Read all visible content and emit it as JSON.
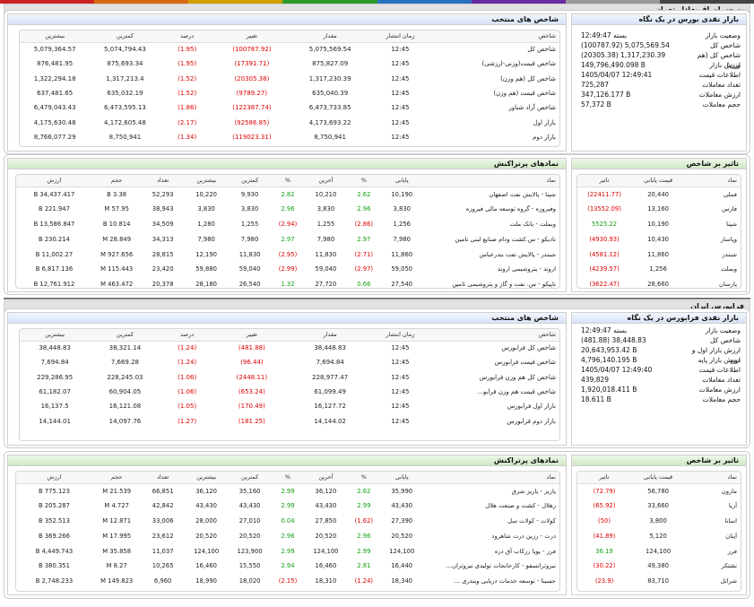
{
  "colors": {
    "accent_green": "#12a012",
    "accent_red": "#dd0000",
    "header_blue": "#d7e3f7",
    "header_green": "#cfe8c4"
  },
  "top_strip": [
    "#cc2222",
    "#d96a10",
    "#cfa000",
    "#2a9a2a",
    "#2a70c0",
    "#6a2aa0",
    "#999999",
    "#444444"
  ],
  "tse": {
    "section_title": "بورس اوراق بهادار تهران",
    "overview": {
      "title": "بازار نقدی بورس در یک نگاه",
      "rows": [
        {
          "label": "وضعیت بازار",
          "value": "بسته 12:49:47",
          "cls": ""
        },
        {
          "label": "شاخص کل",
          "value": "(100787.92) 5,075,569.54",
          "cls": "neg"
        },
        {
          "label": "شاخص کل (هم وزن)",
          "value": "(20305.38) 1,317,230.39",
          "cls": "neg"
        },
        {
          "label": "ارزش بازار",
          "value": "149,796,490.098 B",
          "cls": ""
        },
        {
          "label": "اطلاعات قیمت",
          "value": "1405/04/07 12:49:41",
          "cls": ""
        },
        {
          "label": "تعداد معاملات",
          "value": "725,287",
          "cls": ""
        },
        {
          "label": "ارزش معاملات",
          "value": "347,126.177 B",
          "cls": ""
        },
        {
          "label": "حجم معاملات",
          "value": "57,372 B",
          "cls": ""
        }
      ]
    },
    "indices": {
      "title": "شاخص های منتخب",
      "headers": [
        "شاخص",
        "زمان انتشار",
        "مقدار",
        "تغییر",
        "درصد",
        "کمترین",
        "بیشترین"
      ],
      "rows": [
        [
          "شاخص کل",
          "12:45",
          "5,075,569.54",
          "(100787.92)",
          "(1.95)",
          "5,074,794.43",
          "5,079,364.57"
        ],
        [
          "شاخص قیمت(وزنی-ارزشی)",
          "12:45",
          "875,827.09",
          "(17391.71)",
          "(1.95)",
          "875,693.34",
          "876,481.95"
        ],
        [
          "شاخص کل (هم وزن)",
          "12:45",
          "1,317,230.39",
          "(20305.38)",
          "(1.52)",
          "1,317,213.4",
          "1,322,294.18"
        ],
        [
          "شاخص قیمت (هم وزن)",
          "12:45",
          "635,040.39",
          "(9789.27)",
          "(1.52)",
          "635,032.19",
          "637,481.65"
        ],
        [
          "شاخص آزاد شناور",
          "12:45",
          "6,473,733.85",
          "(122387.74)",
          "(1.86)",
          "6,473,595.13",
          "6,479,043.43"
        ],
        [
          "بازار اول",
          "12:45",
          "4,173,693.22",
          "(92586.85)",
          "(2.17)",
          "4,172,605.48",
          "4,175,630.48"
        ],
        [
          "بازار دوم",
          "12:45",
          "8,750,941",
          "(119023.31)",
          "(1.34)",
          "8,750,941",
          "8,766,077.29"
        ]
      ]
    },
    "impact": {
      "title": "تاثیر بر شاخص",
      "headers": [
        "نماد",
        "قیمت پایانی",
        "تاثیر"
      ],
      "rows": [
        [
          "فملی",
          "20,440",
          "(22411.77)"
        ],
        [
          "فارس",
          "13,160",
          "(13552.09)"
        ],
        [
          "شپنا",
          "10,190",
          "5525.22"
        ],
        [
          "وپاسار",
          "10,430",
          "(4930.93)"
        ],
        [
          "شبندر",
          "11,860",
          "(4581.12)"
        ],
        [
          "وبملت",
          "1,256",
          "(4239.57)"
        ],
        [
          "پارسان",
          "28,660",
          "(3622.47)"
        ]
      ]
    },
    "symbols": {
      "title": "نمادهای پرتراکنش",
      "headers": [
        "نماد",
        "پایانی",
        "%",
        "آخرین",
        "%",
        "کمترین",
        "بیشترین",
        "تعداد",
        "حجم",
        "ارزش"
      ],
      "rows": [
        [
          "شپنا - پالایش نفت اصفهان",
          "10,190",
          "2.62",
          "10,210",
          "2.82",
          "9,930",
          "10,220",
          "52,293",
          "3.38 B",
          "34,437.417 B"
        ],
        [
          "وفیروزه - گروه توسعه مالی فیروزه",
          "3,830",
          "2.96",
          "3,830",
          "2.96",
          "3,830",
          "3,830",
          "38,943",
          "57.95 M",
          "221.947 B"
        ],
        [
          "وبملت - بانک ملت",
          "1,256",
          "(2.86)",
          "1,255",
          "(2.94)",
          "1,255",
          "1,280",
          "34,509",
          "10.814 B",
          "13,586.847 B"
        ],
        [
          "نادیکو - س.کشت ودام صنایع لبنی نامین",
          "7,980",
          "2.97",
          "7,980",
          "2.97",
          "7,980",
          "7,980",
          "34,313",
          "28.849 M",
          "230.214 B"
        ],
        [
          "شبندر - پالایش نفت بندرعباس",
          "11,860",
          "(2.71)",
          "11,830",
          "(2.95)",
          "11,830",
          "12,190",
          "28,815",
          "927.656 M",
          "11,002.27 B"
        ],
        [
          "اروند - پتروشیمی اروند",
          "59,050",
          "(2.97)",
          "59,040",
          "(2.99)",
          "59,040",
          "59,880",
          "23,420",
          "115.443 M",
          "6,817.136 B"
        ],
        [
          "ناپیکو - س. نفت و گاز و پتروشیمی تامین",
          "27,540",
          "0.66",
          "27,720",
          "1.32",
          "26,540",
          "28,180",
          "20,378",
          "463.472 M",
          "12,761.912 B"
        ]
      ]
    }
  },
  "ifb": {
    "section_title": "فرابورس ایران",
    "overview": {
      "title": "بازار نقدی فرابورس در یک نگاه",
      "rows": [
        {
          "label": "وضعیت بازار",
          "value": "بسته 12:49:47",
          "cls": ""
        },
        {
          "label": "شاخص کل",
          "value": "(481.88) 38,448.83",
          "cls": "neg"
        },
        {
          "label": "ارزش بازار اول و دوم",
          "value": "20,643,953.42 B",
          "cls": ""
        },
        {
          "label": "ارزش بازار پایه",
          "value": "4,796,140.195 B",
          "cls": ""
        },
        {
          "label": "اطلاعات قیمت",
          "value": "1405/04/07 12:49:40",
          "cls": ""
        },
        {
          "label": "تعداد معاملات",
          "value": "439,829",
          "cls": ""
        },
        {
          "label": "ارزش معاملات",
          "value": "1,920,018.411 B",
          "cls": ""
        },
        {
          "label": "حجم معاملات",
          "value": "18.611 B",
          "cls": ""
        }
      ]
    },
    "indices": {
      "title": "شاخص های منتخب",
      "headers": [
        "شاخص",
        "زمان انتشار",
        "مقدار",
        "تغییر",
        "درصد",
        "کمترین",
        "بیشترین"
      ],
      "rows": [
        [
          "شاخص کل فرابورس",
          "12:45",
          "38,448.83",
          "(481.88)",
          "(1.24)",
          "38,321.14",
          "38,448.83"
        ],
        [
          "شاخص قیمت فرابورس",
          "12:45",
          "7,694.84",
          "(96.44)",
          "(1.24)",
          "7,669.28",
          "7,694.84"
        ],
        [
          "شاخص کل هم وزن فرابورس",
          "12:45",
          "228,977.47",
          "(2448.11)",
          "(1.06)",
          "228,245.03",
          "229,286.95"
        ],
        [
          "شاخص قیمت هم وزن فرابو...",
          "12:45",
          "61,099.49",
          "(653.24)",
          "(1.06)",
          "60,904.05",
          "61,182.07"
        ],
        [
          "بازار اول فرابورس",
          "12:45",
          "16,127.72",
          "(170.49)",
          "(1.05)",
          "16,121.08",
          "16,137.5"
        ],
        [
          "بازار دوم فرابورس",
          "12:45",
          "14,144.02",
          "(181.25)",
          "(1.27)",
          "14,097.76",
          "14,144.01"
        ]
      ]
    },
    "impact": {
      "title": "تاثیر بر شاخص",
      "headers": [
        "نماد",
        "قیمت پایانی",
        "تاثیر"
      ],
      "rows": [
        [
          "مارون",
          "56,780",
          "(72.79)"
        ],
        [
          "آریا",
          "33,660",
          "(65.92)"
        ],
        [
          "اسانا",
          "3,800",
          "(50)"
        ],
        [
          "آپتان",
          "5,120",
          "(41.89)"
        ],
        [
          "فرز",
          "124,100",
          "36.19"
        ],
        [
          "نشتکر",
          "49,380",
          "(30.22)"
        ],
        [
          "شراتل",
          "83,710",
          "(23.9)"
        ]
      ]
    },
    "symbols": {
      "title": "نمادهای پرتراکنش",
      "headers": [
        "نماد",
        "پایانی",
        "%",
        "آخرین",
        "%",
        "کمترین",
        "بیشترین",
        "تعداد",
        "حجم",
        "ارزش"
      ],
      "rows": [
        [
          "پاریز - پاریز شرق",
          "35,990",
          "2.62",
          "36,120",
          "2.99",
          "35,160",
          "36,120",
          "66,851",
          "21.539 M",
          "775.123 B"
        ],
        [
          "زهلال - کشت و صنعت هلال",
          "43,430",
          "2.99",
          "43,430",
          "2.99",
          "43,430",
          "43,430",
          "42,842",
          "4.727 M",
          "205.287 B"
        ],
        [
          "کولات - کولات سل",
          "27,390",
          "(1.62)",
          "27,850",
          "0.04",
          "27,010",
          "28,000",
          "33,006",
          "12.871 M",
          "352.513 B"
        ],
        [
          "درت - رزین درت شاهرود",
          "20,520",
          "2.96",
          "20,520",
          "2.96",
          "20,520",
          "20,520",
          "23,612",
          "17.995 M",
          "369.266 B"
        ],
        [
          "فرز - پویا رزکاب آق دره",
          "124,100",
          "2.99",
          "124,100",
          "2.99",
          "123,900",
          "124,100",
          "11,037",
          "35.858 M",
          "4,449.743 B"
        ],
        [
          "نیروترانسفو - کارخانجات تولیدی نیروتران...",
          "16,440",
          "2.81",
          "16,460",
          "2.94",
          "15,550",
          "16,460",
          "10,265",
          "8.27 M",
          "380.351 B"
        ],
        [
          "حسینا - توسعه خدمات دریایی وبندری ...",
          "18,340",
          "(1.24)",
          "18,310",
          "(2.15)",
          "18,020",
          "18,990",
          "6,960",
          "149.823 M",
          "2,748.233 B"
        ]
      ]
    }
  }
}
